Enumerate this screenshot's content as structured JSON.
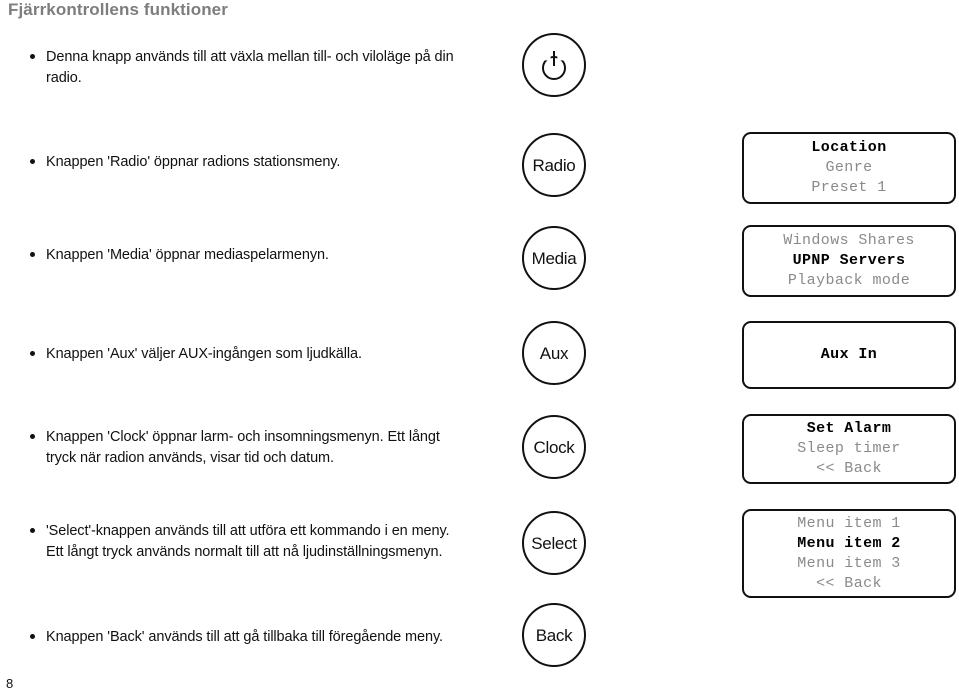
{
  "document": {
    "title": "Fjärrkontrollens funktioner",
    "page_number": "8"
  },
  "rows": [
    {
      "id": "power",
      "bullet_lines": [
        "Denna knapp används till att växla mellan till- och viloläge på din",
        "radio."
      ],
      "button_label": "",
      "button_icon": "power-icon",
      "display": null
    },
    {
      "id": "radio",
      "bullet_lines": [
        "Knappen 'Radio' öppnar radions stationsmeny."
      ],
      "button_label": "Radio",
      "button_icon": null,
      "display": {
        "lines": [
          {
            "text": "Location",
            "selected": true
          },
          {
            "text": "Genre",
            "selected": false
          },
          {
            "text": "Preset 1",
            "selected": false
          }
        ]
      }
    },
    {
      "id": "media",
      "bullet_lines": [
        "Knappen 'Media' öppnar mediaspelarmenyn."
      ],
      "button_label": "Media",
      "button_icon": null,
      "display": {
        "lines": [
          {
            "text": "Windows Shares",
            "selected": false
          },
          {
            "text": "UPNP Servers",
            "selected": true
          },
          {
            "text": "Playback mode",
            "selected": false
          }
        ]
      }
    },
    {
      "id": "aux",
      "bullet_lines": [
        "Knappen 'Aux' väljer AUX-ingången som ljudkälla."
      ],
      "button_label": "Aux",
      "button_icon": null,
      "display": {
        "lines": [
          {
            "text": "Aux In",
            "selected": true
          }
        ]
      }
    },
    {
      "id": "clock",
      "bullet_lines": [
        "Knappen 'Clock' öppnar larm- och insomningsmenyn. Ett långt",
        "tryck när radion används, visar tid och datum."
      ],
      "button_label": "Clock",
      "button_icon": null,
      "display": {
        "lines": [
          {
            "text": "Set Alarm",
            "selected": true
          },
          {
            "text": "Sleep timer",
            "selected": false
          },
          {
            "text": "<< Back",
            "selected": false
          }
        ]
      }
    },
    {
      "id": "select",
      "bullet_lines": [
        "'Select'-knappen används till att utföra ett kommando i en meny.",
        "Ett långt tryck används normalt till att nå ljudinställningsmenyn."
      ],
      "button_label": "Select",
      "button_icon": null,
      "display": {
        "lines": [
          {
            "text": "Menu item 1",
            "selected": false
          },
          {
            "text": "Menu item 2",
            "selected": true
          },
          {
            "text": "Menu item 3",
            "selected": false
          },
          {
            "text": "<< Back",
            "selected": false
          }
        ]
      }
    },
    {
      "id": "back",
      "bullet_lines": [
        "Knappen 'Back' används till att gå tillbaka till föregående meny."
      ],
      "button_label": "Back",
      "button_icon": null,
      "display": null
    }
  ]
}
